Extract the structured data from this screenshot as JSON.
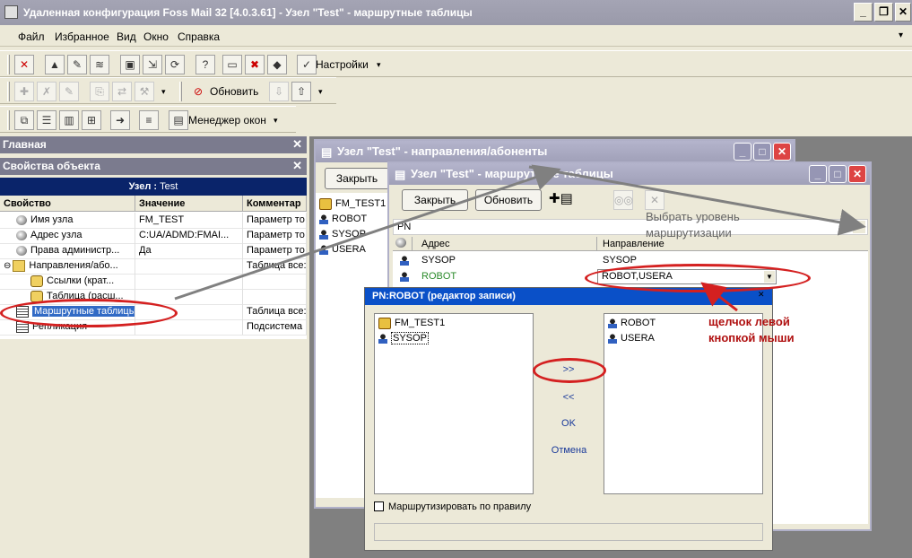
{
  "window": {
    "title": "Удаленная конфигурация Foss Mail 32 [4.0.3.61] - Узел \"Test\" - маршрутные таблицы",
    "buttons": [
      "_",
      "❐",
      "✕"
    ]
  },
  "menu": [
    "Файл",
    "Избранное",
    "Вид",
    "Окно",
    "Справка"
  ],
  "toolbar1": {
    "settings_label": "Настройки"
  },
  "toolbar2": {
    "refresh_label": "Обновить"
  },
  "toolbar3": {
    "window_manager_label": "Менеджер окон"
  },
  "left_panel": {
    "main_header": "Главная",
    "props_header": "Свойства объекта",
    "object_title_prefix": "Узел :",
    "object_title_name": "Test",
    "columns": [
      "Свойство",
      "Значение",
      "Комментар"
    ],
    "rows": [
      {
        "name": "Имя узла",
        "value": "FM_TEST",
        "comment": "Параметр то",
        "icon": "key-icon"
      },
      {
        "name": "Адрес узла",
        "value": "C:UA/ADMD:FMAI...",
        "comment": "Параметр то",
        "icon": "key-icon"
      },
      {
        "name": "Права администр...",
        "value": "Да",
        "comment": "Параметр то",
        "icon": "key-icon"
      },
      {
        "name": "Направления/або...",
        "value": "",
        "comment": "Таблица все:",
        "icon": "folder-icon"
      },
      {
        "name": "Ссылки (крат...",
        "value": "",
        "comment": "",
        "icon": "link-icon"
      },
      {
        "name": "Таблица (расш...",
        "value": "",
        "comment": "",
        "icon": "link-icon"
      },
      {
        "name": "Маршрутные таблицы",
        "value": "",
        "comment": "Таблица все:",
        "icon": "table-icon"
      },
      {
        "name": "Репликация",
        "value": "",
        "comment": "Подсистема",
        "icon": "table-icon"
      }
    ]
  },
  "win_directions": {
    "title": "Узел \"Test\" - направления/абоненты",
    "close_label": "Закрыть",
    "items": [
      "FM_TEST1",
      "ROBOT",
      "SYSOP",
      "USERA"
    ]
  },
  "win_routes": {
    "title": "Узел \"Test\" - маршрутные таблицы",
    "close_label": "Закрыть",
    "refresh_label": "Обновить",
    "level_value": "PN",
    "columns": [
      "Адрес",
      "Направление"
    ],
    "rows": [
      {
        "address": "SYSOP",
        "direction": "SYSOP"
      },
      {
        "address": "ROBOT",
        "direction": "ROBOT,USERA"
      }
    ]
  },
  "editor": {
    "title": "PN:ROBOT (редактор записи)",
    "left_items": [
      "FM_TEST1",
      "SYSOP"
    ],
    "right_items": [
      "ROBOT",
      "USERA"
    ],
    "add_label": ">>",
    "remove_label": "<<",
    "ok_label": "OK",
    "cancel_label": "Отмена",
    "checkbox_label": "Маршрутизировать по правилу"
  },
  "annotations": {
    "level_hint_line1": "Выбрать уровень",
    "level_hint_line2": "маршрутизации",
    "click_hint_line1": "щелчок левой",
    "click_hint_line2": "кнопкой мыши"
  },
  "colors": {
    "annotation_red": "#d42020",
    "arrow_gray": "#808080",
    "selection_blue": "#316ac5"
  }
}
